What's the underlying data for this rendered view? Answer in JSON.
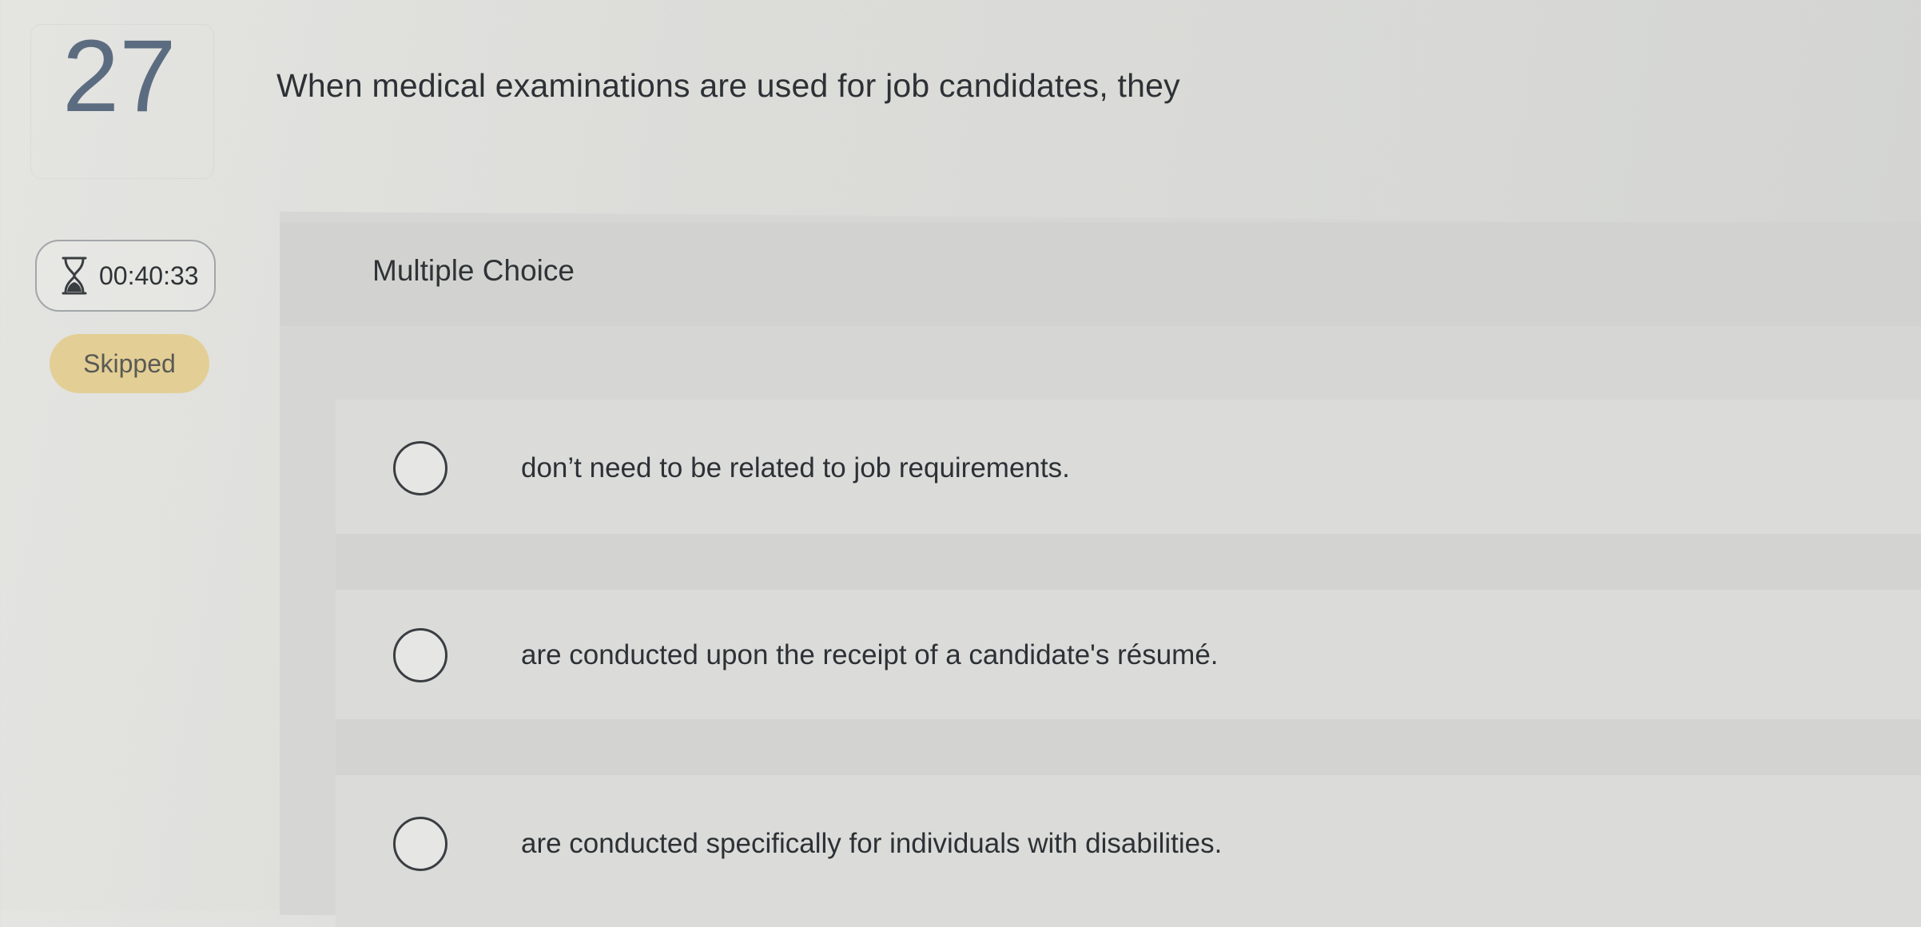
{
  "question": {
    "number": "27",
    "prompt": "When medical examinations are used for job candidates, they"
  },
  "timer": {
    "time": "00:40:33"
  },
  "status_badge": "Skipped",
  "panel": {
    "label": "Multiple Choice"
  },
  "choices": [
    {
      "label": "don’t need to be related to job requirements."
    },
    {
      "label": "are conducted upon the receipt of a candidate's résumé."
    },
    {
      "label": "are conducted specifically for individuals with disabilities."
    }
  ]
}
